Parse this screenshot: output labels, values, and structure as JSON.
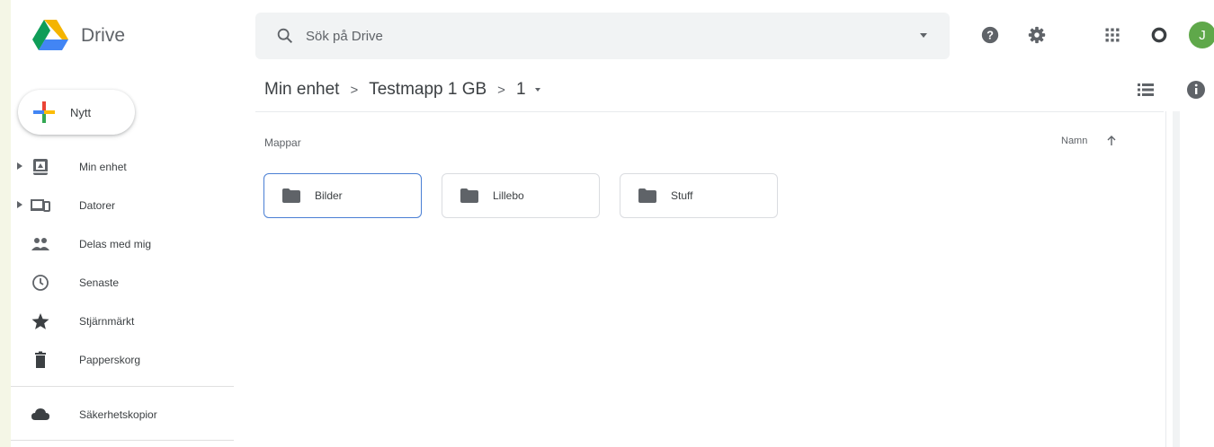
{
  "header": {
    "product_name": "Drive",
    "search_placeholder": "Sök på Drive",
    "avatar_initial": "J"
  },
  "sidebar": {
    "new_label": "Nytt",
    "items": [
      {
        "label": "Min enhet",
        "icon": "my-drive-icon",
        "expandable": true
      },
      {
        "label": "Datorer",
        "icon": "computers-icon",
        "expandable": true
      },
      {
        "label": "Delas med mig",
        "icon": "shared-people-icon",
        "expandable": false
      },
      {
        "label": "Senaste",
        "icon": "clock-icon",
        "expandable": false
      },
      {
        "label": "Stjärnmärkt",
        "icon": "star-icon",
        "expandable": false
      },
      {
        "label": "Papperskorg",
        "icon": "trash-icon",
        "expandable": false
      }
    ],
    "backup_label": "Säkerhetskopior"
  },
  "breadcrumb": {
    "items": [
      "Min enhet",
      "Testmapp 1 GB",
      "1"
    ]
  },
  "main": {
    "section_title": "Mappar",
    "sort_label": "Namn",
    "folders": [
      {
        "name": "Bilder",
        "selected": true
      },
      {
        "name": "Lillebo",
        "selected": false
      },
      {
        "name": "Stuff",
        "selected": false
      }
    ]
  },
  "colors": {
    "accent_blue": "#4a7fd4",
    "avatar_green": "#5fa84a",
    "icon_gray": "#5f6368"
  }
}
